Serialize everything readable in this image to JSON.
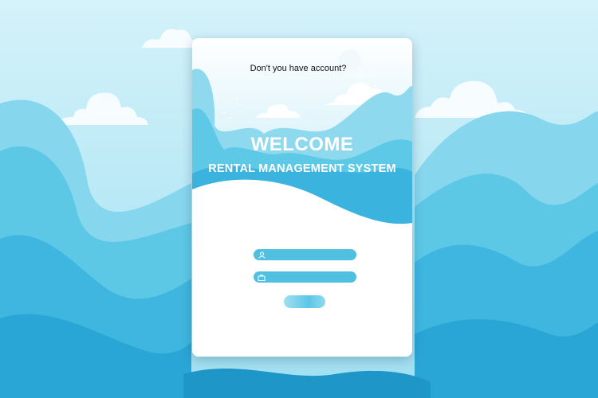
{
  "header": {
    "signup_prompt": "Don't you have account?"
  },
  "hero": {
    "title": "WELCOME",
    "subtitle": "RENTAL MANAGEMENT SYSTEM"
  },
  "form": {
    "username": {
      "value": "",
      "icon": "user-icon"
    },
    "password": {
      "value": "",
      "icon": "lock-icon"
    },
    "login_button_label": ""
  },
  "colors": {
    "sky": "#c8eef8",
    "wave_light": "#7dd3ec",
    "wave_mid": "#4fc0e2",
    "wave_dark": "#2ba8d6",
    "card": "#ffffff",
    "field": "#4fc0df"
  }
}
